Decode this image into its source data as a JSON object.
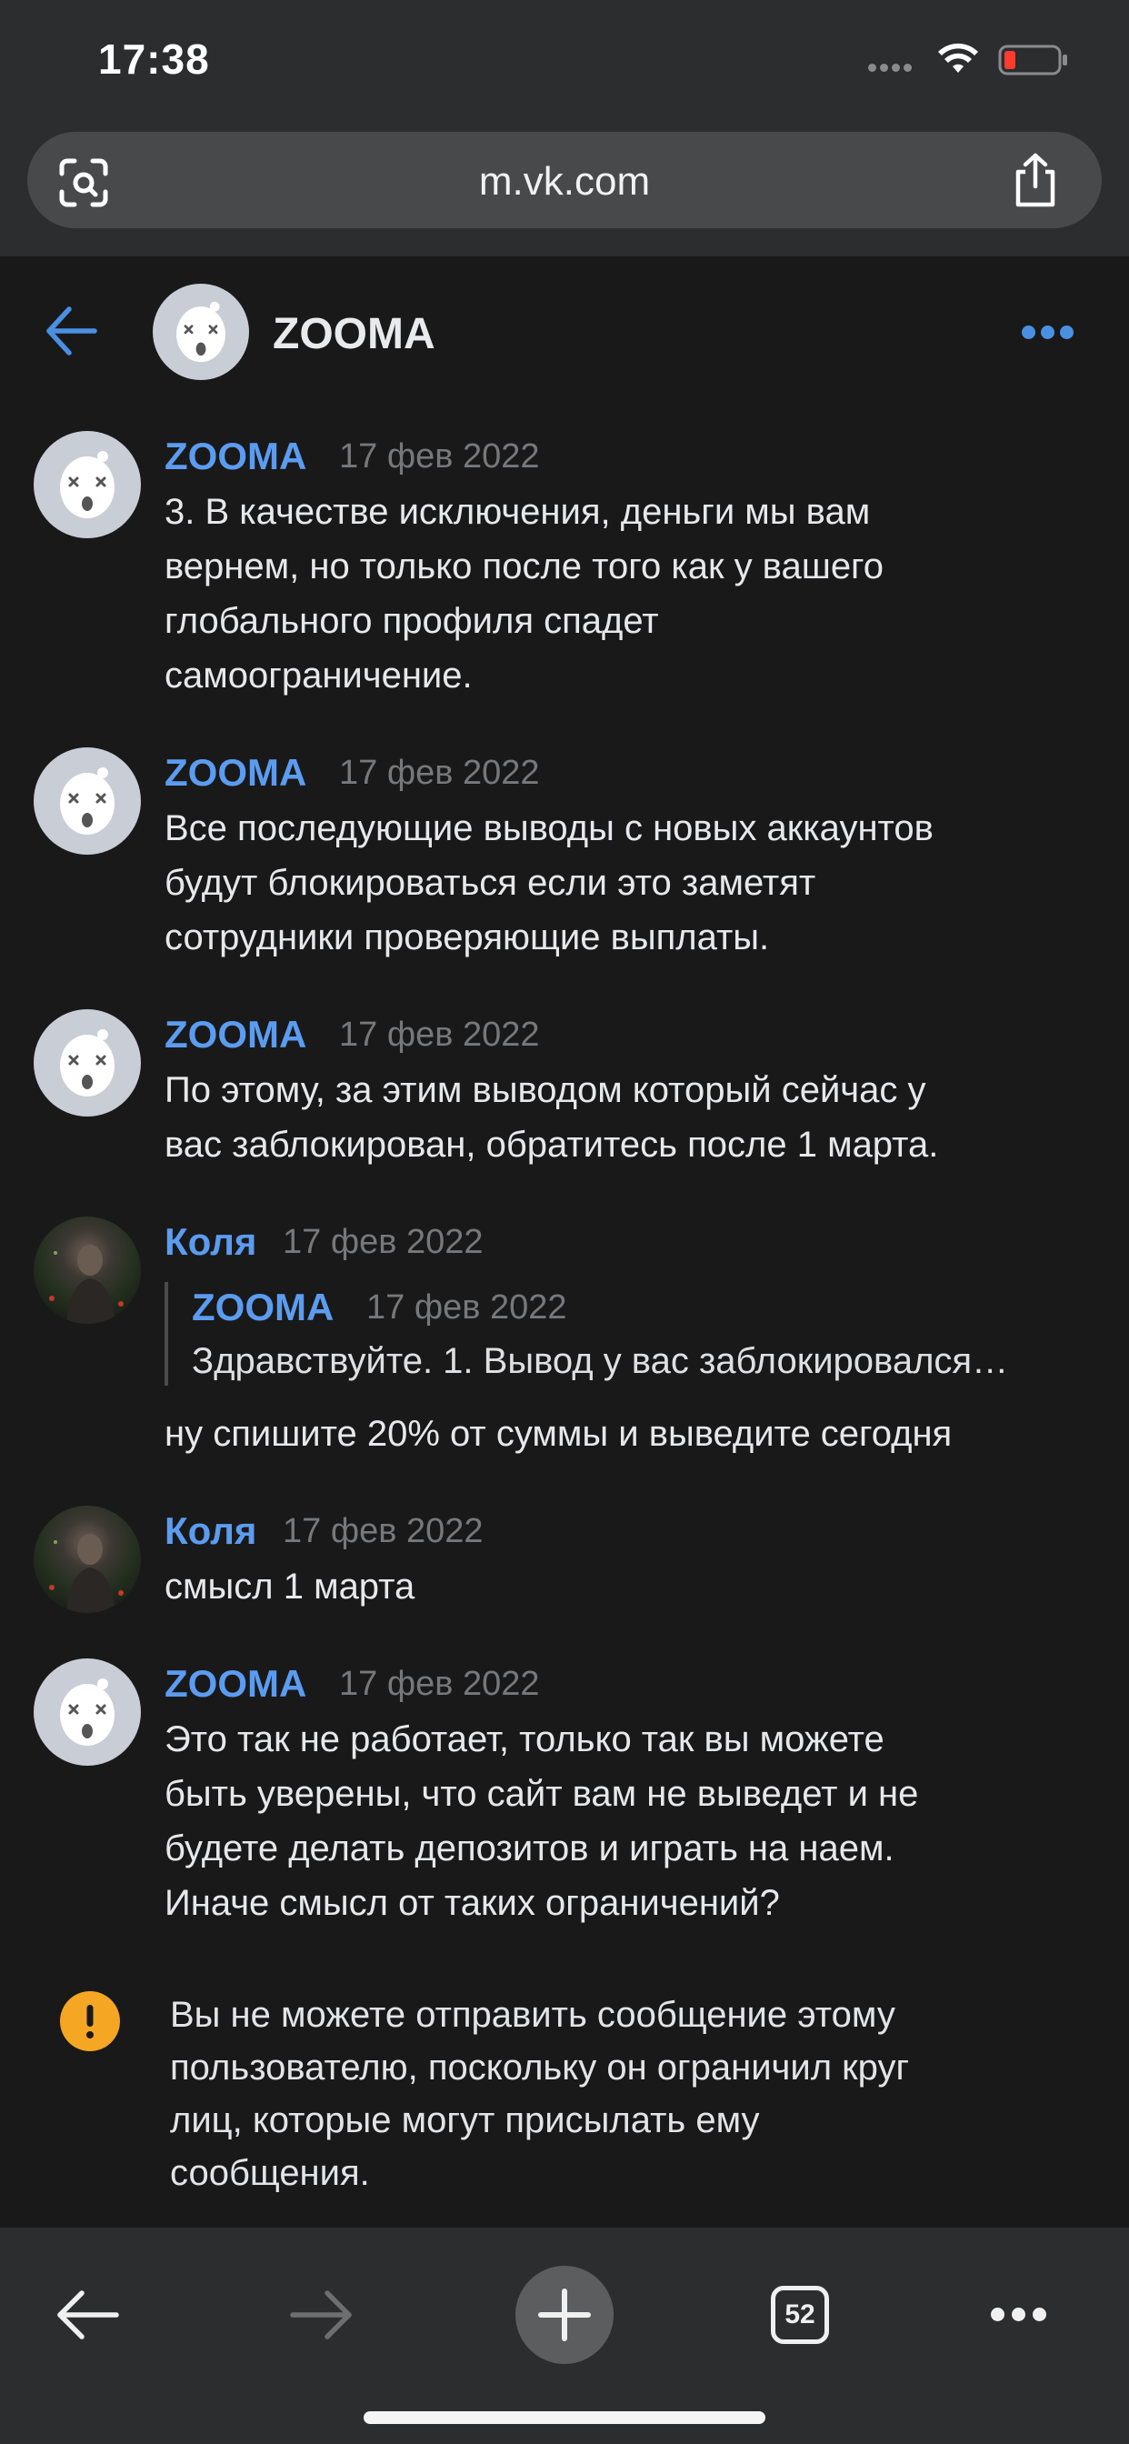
{
  "status_bar": {
    "time": "17:38"
  },
  "browser": {
    "url": "m.vk.com",
    "tab_count": "52"
  },
  "chat": {
    "title": "ZOOMA"
  },
  "messages": [
    {
      "author": "ZOOMA",
      "date": "17 фев 2022",
      "lines": [
        "3. В качестве исключения, деньги мы вам",
        "вернем, но только после того как у вашего",
        "глобального профиля спадет",
        "самоограничение."
      ]
    },
    {
      "author": "ZOOMA",
      "date": "17 фев 2022",
      "lines": [
        "Все последующие выводы с новых аккаунтов",
        "будут блокироваться если это заметят",
        "сотрудники проверяющие выплаты."
      ]
    },
    {
      "author": "ZOOMA",
      "date": "17 фев 2022",
      "lines": [
        "По этому, за этим выводом который сейчас у",
        "вас заблокирован, обратитесь после 1 марта."
      ]
    },
    {
      "author": "Коля",
      "date": "17 фев 2022",
      "quote": {
        "author": "ZOOMA",
        "date": "17 фев 2022",
        "text": "Здравствуйте. 1. Вывод у вас заблокировался…"
      },
      "lines": [
        "ну спишите 20% от суммы и выведите сегодня"
      ]
    },
    {
      "author": "Коля",
      "date": "17 фев 2022",
      "lines": [
        "смысл 1 марта"
      ]
    },
    {
      "author": "ZOOMA",
      "date": "17 фев 2022",
      "lines": [
        "Это так не работает, только так вы можете",
        "быть уверены, что сайт вам не выведет и не",
        "будете делать депозитов и играть на наем.",
        "Иначе смысл от таких ограничений?"
      ]
    }
  ],
  "notice": {
    "lines": [
      "Вы не можете отправить сообщение этому",
      "пользователю, поскольку он ограничил круг",
      "лиц, которые могут присылать ему",
      "сообщения."
    ]
  },
  "colors": {
    "accent": "#5b9cf0",
    "warning": "#f5a623",
    "background": "#19191a"
  }
}
